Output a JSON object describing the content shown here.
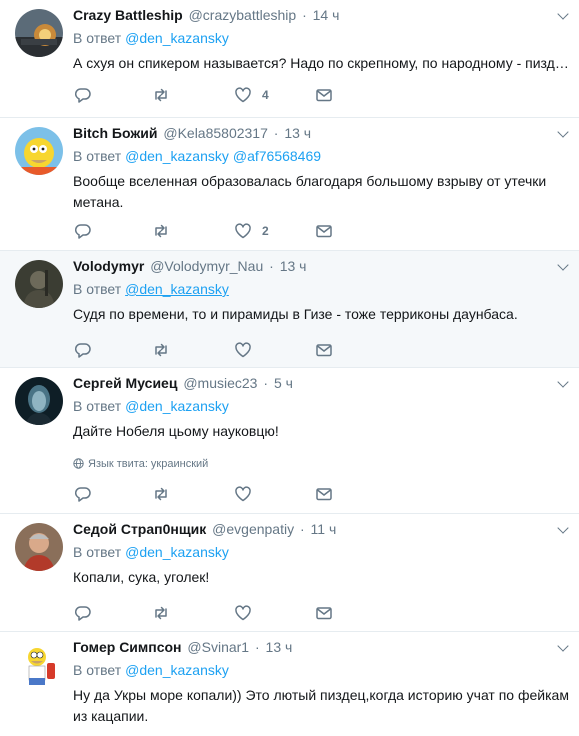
{
  "reply_prefix": "В ответ",
  "tweets": [
    {
      "name": "Crazy Battleship",
      "handle": "@crazybattleship",
      "time": "14 ч",
      "mentions": [
        "@den_kazansky"
      ],
      "text": "А схуя он спикером называется? Надо по скрепному, по народному - пиздун...",
      "likes": "4"
    },
    {
      "name": "Bitch Божий",
      "handle": "@Kela85802317",
      "time": "13 ч",
      "mentions": [
        "@den_kazansky",
        "@af76568469"
      ],
      "text": "Вообще вселенная образовалась благодаря большому взрыву от утечки метана.",
      "likes": "2"
    },
    {
      "name": "Volodymyr",
      "handle": "@Volodymyr_Nau",
      "time": "13 ч",
      "mentions": [
        "@den_kazansky"
      ],
      "text": "Судя по времени, то и пирамиды в Гизе - тоже терриконы даунбаса.",
      "likes": ""
    },
    {
      "name": "Сергей Мусиец",
      "handle": "@musiec23",
      "time": "5 ч",
      "mentions": [
        "@den_kazansky"
      ],
      "text": "Дайте Нобеля цьому науковцю!",
      "lang": "Язык твита: украинский",
      "likes": ""
    },
    {
      "name": "Седой Страп0нщик",
      "handle": "@evgenpatiy",
      "time": "11 ч",
      "mentions": [
        "@den_kazansky"
      ],
      "text": "Копали, сука, уголек!",
      "likes": ""
    },
    {
      "name": "Гомер Симпсон",
      "handle": "@Svinar1",
      "time": "13 ч",
      "mentions": [
        "@den_kazansky"
      ],
      "text": "Ну да Укры море копали)) Это лютый пиздец,когда историю учат по фейкам из кацапии.",
      "likes": ""
    }
  ],
  "colors": {
    "link": "#1da1f2",
    "muted": "#657786",
    "text": "#14171a",
    "highlight_bg": "#f5f8fa",
    "border": "#e6ecf0"
  },
  "icons": [
    "reply-icon",
    "retweet-icon",
    "like-icon",
    "message-icon",
    "caret-down-icon",
    "globe-icon"
  ]
}
